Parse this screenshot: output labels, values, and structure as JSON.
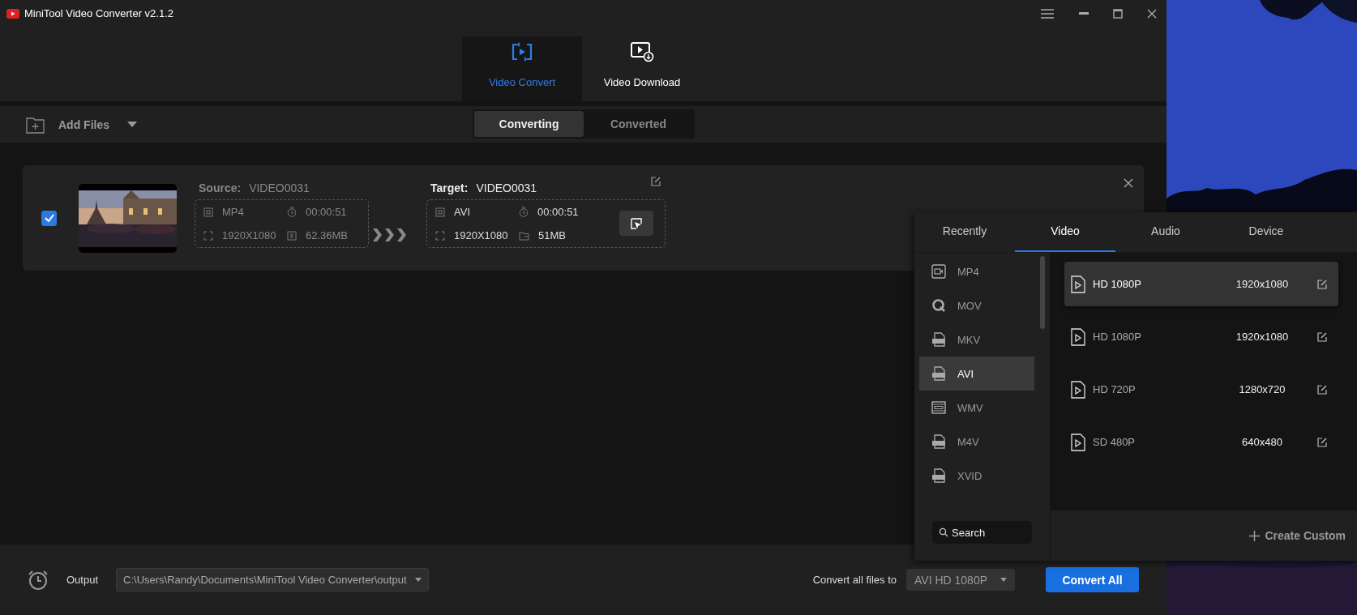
{
  "window": {
    "title": "MiniTool Video Converter v2.1.2"
  },
  "main_tabs": [
    {
      "label": "Video Convert",
      "selected": true
    },
    {
      "label": "Video Download",
      "selected": false
    }
  ],
  "toolbar": {
    "add_files": "Add Files"
  },
  "sub_tabs": [
    {
      "label": "Converting",
      "selected": true
    },
    {
      "label": "Converted",
      "selected": false
    }
  ],
  "file": {
    "checked": true,
    "source": {
      "label": "Source:",
      "name": "VIDEO0031",
      "format": "MP4",
      "duration": "00:00:51",
      "resolution": "1920X1080",
      "size": "62.36MB"
    },
    "target": {
      "label": "Target:",
      "name": "VIDEO0031",
      "format": "AVI",
      "duration": "00:00:51",
      "resolution": "1920X1080",
      "size": "51MB"
    }
  },
  "format_panel": {
    "tabs": [
      {
        "label": "Recently",
        "selected": false
      },
      {
        "label": "Video",
        "selected": true
      },
      {
        "label": "Audio",
        "selected": false
      },
      {
        "label": "Device",
        "selected": false
      }
    ],
    "formats": [
      {
        "label": "MP4",
        "selected": false
      },
      {
        "label": "MOV",
        "selected": false
      },
      {
        "label": "MKV",
        "selected": false
      },
      {
        "label": "AVI",
        "selected": true
      },
      {
        "label": "WMV",
        "selected": false
      },
      {
        "label": "M4V",
        "selected": false
      },
      {
        "label": "XVID",
        "selected": false
      }
    ],
    "search": {
      "placeholder": "Search"
    },
    "presets": [
      {
        "name": "HD 1080P",
        "resolution": "1920x1080",
        "selected": true
      },
      {
        "name": "HD 1080P",
        "resolution": "1920x1080",
        "selected": false
      },
      {
        "name": "HD 720P",
        "resolution": "1280x720",
        "selected": false
      },
      {
        "name": "SD 480P",
        "resolution": "640x480",
        "selected": false
      }
    ],
    "create_custom": "Create Custom"
  },
  "bottom": {
    "output_label": "Output",
    "output_path": "C:\\Users\\Randy\\Documents\\MiniTool Video Converter\\output",
    "convert_all_label": "Convert all files to",
    "convert_all_value": "AVI HD 1080P",
    "convert_all_button": "Convert All"
  }
}
